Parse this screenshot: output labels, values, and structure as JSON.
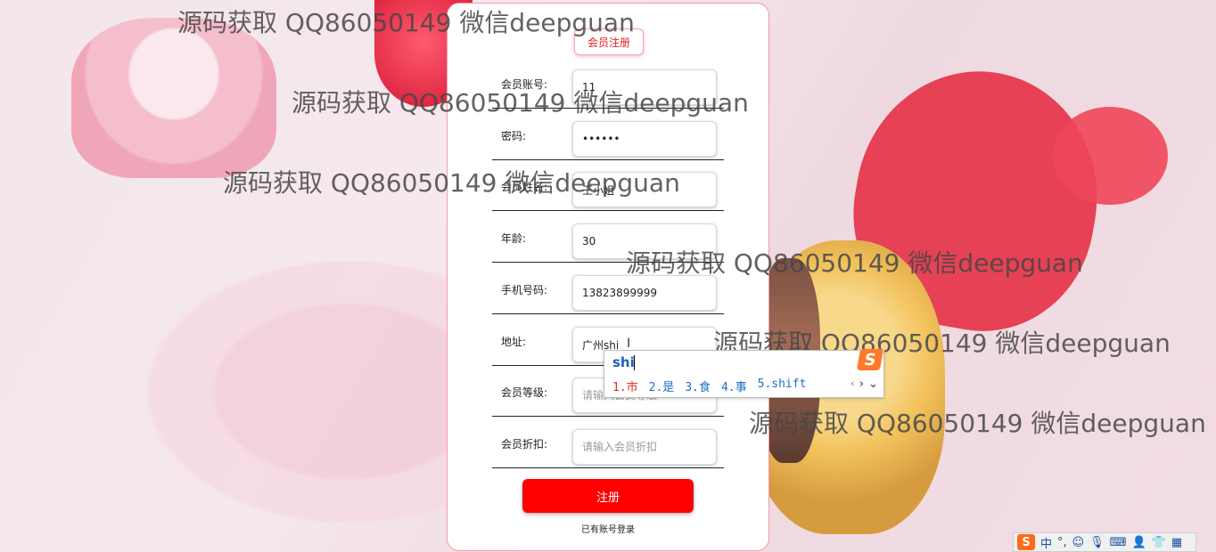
{
  "form": {
    "title": "会员注册",
    "fields": [
      {
        "label": "会员账号:",
        "value": "11",
        "placeholder": ""
      },
      {
        "label": "密码:",
        "value": "••••••",
        "placeholder": ""
      },
      {
        "label": "会员姓名:",
        "value": "王小姐",
        "placeholder": ""
      },
      {
        "label": "年龄:",
        "value": "30",
        "placeholder": ""
      },
      {
        "label": "手机号码:",
        "value": "13823899999",
        "placeholder": ""
      },
      {
        "label": "地址:",
        "value": "广州shi",
        "placeholder": ""
      },
      {
        "label": "会员等级:",
        "value": "",
        "placeholder": "请输入会员等级"
      },
      {
        "label": "会员折扣:",
        "value": "",
        "placeholder": "请输入会员折扣"
      }
    ],
    "submit_label": "注册",
    "login_link": "已有账号登录"
  },
  "ime": {
    "input": "shi",
    "candidates": [
      "1.市",
      "2.是",
      "3.食",
      "4.事",
      "5.shift"
    ],
    "logo": "S"
  },
  "taskbar": {
    "items": [
      "中",
      "°,"
    ]
  },
  "watermarks": [
    "源码获取 QQ86050149 微信deepguan",
    "源码获取 QQ86050149 微信deepguan",
    "源码获取 QQ86050149 微信deepguan",
    "源码获取 QQ86050149 微信deepguan",
    "源码获取 QQ86050149 微信deepguan",
    "源码获取 QQ86050149 微信deepguan"
  ]
}
